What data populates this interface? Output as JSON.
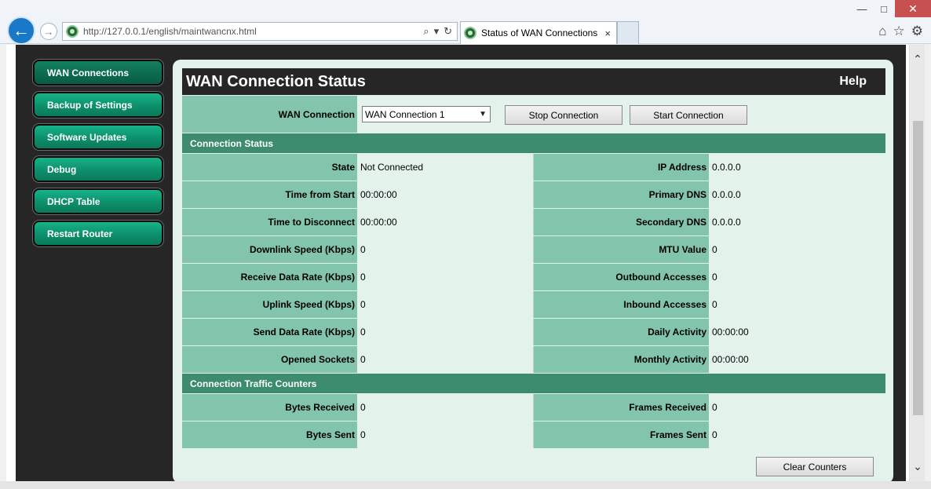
{
  "browser": {
    "url": "http://127.0.0.1/english/maintwancnx.html",
    "tab_title": "Status of WAN Connections",
    "tab_close": "×",
    "back_glyph": "←",
    "forward_glyph": "→",
    "search_glyph": "⌕",
    "dropdown_glyph": "▾",
    "refresh_glyph": "↻",
    "home_glyph": "⌂",
    "star_glyph": "☆",
    "gear_glyph": "⚙",
    "minimize_glyph": "—",
    "maximize_glyph": "□",
    "close_glyph": "✕"
  },
  "sidebar": {
    "items": [
      {
        "label": "WAN Connections"
      },
      {
        "label": "Backup of Settings"
      },
      {
        "label": "Software Updates"
      },
      {
        "label": "Debug"
      },
      {
        "label": "DHCP Table"
      },
      {
        "label": "Restart Router"
      }
    ]
  },
  "header": {
    "title": "WAN Connection Status",
    "help": "Help"
  },
  "wan": {
    "label": "WAN Connection",
    "selected": "WAN Connection 1",
    "stop_label": "Stop Connection",
    "start_label": "Start Connection"
  },
  "status": {
    "section_title": "Connection Status",
    "rows": [
      {
        "l_label": "State",
        "l_value": "Not Connected",
        "r_label": "IP Address",
        "r_value": "0.0.0.0"
      },
      {
        "l_label": "Time from Start",
        "l_value": "00:00:00",
        "r_label": "Primary DNS",
        "r_value": "0.0.0.0"
      },
      {
        "l_label": "Time to Disconnect",
        "l_value": "00:00:00",
        "r_label": "Secondary DNS",
        "r_value": "0.0.0.0"
      },
      {
        "l_label": "Downlink Speed (Kbps)",
        "l_value": "0",
        "r_label": "MTU Value",
        "r_value": "0"
      },
      {
        "l_label": "Receive Data Rate (Kbps)",
        "l_value": "0",
        "r_label": "Outbound Accesses",
        "r_value": "0"
      },
      {
        "l_label": "Uplink Speed (Kbps)",
        "l_value": "0",
        "r_label": "Inbound Accesses",
        "r_value": "0"
      },
      {
        "l_label": "Send Data Rate (Kbps)",
        "l_value": "0",
        "r_label": "Daily Activity",
        "r_value": "00:00:00"
      },
      {
        "l_label": "Opened Sockets",
        "l_value": "0",
        "r_label": "Monthly Activity",
        "r_value": "00:00:00"
      }
    ]
  },
  "traffic": {
    "section_title": "Connection Traffic Counters",
    "rows": [
      {
        "l_label": "Bytes Received",
        "l_value": "0",
        "r_label": "Frames Received",
        "r_value": "0"
      },
      {
        "l_label": "Bytes Sent",
        "l_value": "0",
        "r_label": "Frames Sent",
        "r_value": "0"
      }
    ],
    "clear_label": "Clear Counters"
  },
  "colors": {
    "accent_green": "#3c8c6d",
    "label_green": "#83c4ad",
    "panel_bg": "#e4f2ec",
    "dark_bg": "#262626"
  }
}
